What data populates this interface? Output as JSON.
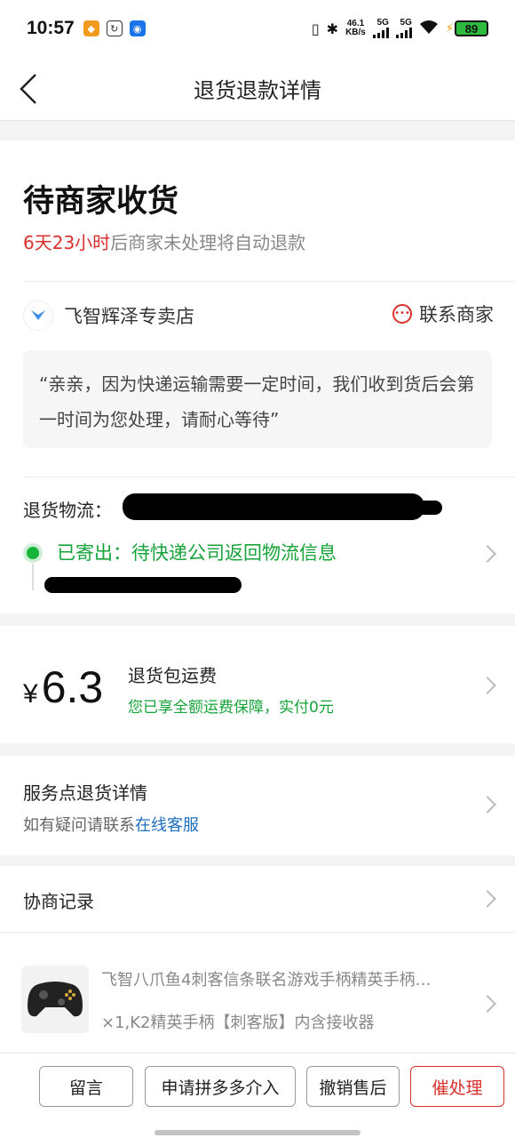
{
  "status_bar": {
    "time": "10:57",
    "net_speed_value": "46.1",
    "net_speed_unit": "KB/s",
    "sig1_label": "5G",
    "sig2_label": "5G",
    "battery": "89"
  },
  "nav": {
    "title": "退货退款详情"
  },
  "status": {
    "title": "待商家收货",
    "countdown": "6天23小时",
    "countdown_suffix": "后商家未处理将自动退款"
  },
  "shop": {
    "name": "飞智辉泽专卖店",
    "contact_label": "联系商家",
    "message": "“亲亲，因为快递运输需要一定时间，我们收到货后会第一时间为您处理，请耐心等待”"
  },
  "logistics": {
    "label": "退货物流：",
    "status": "已寄出：待快递公司返回物流信息"
  },
  "shipping_fee": {
    "currency": "¥",
    "amount": "6.3",
    "title": "退货包运费",
    "subtitle": "您已享全额运费保障，实付0元"
  },
  "service_point": {
    "title": "服务点退货详情",
    "sub_prefix": "如有疑问请联系",
    "sub_link": "在线客服"
  },
  "negotiation": {
    "title": "协商记录"
  },
  "product": {
    "name": "飞智八爪鱼4刺客信条联名游戏手柄精英手柄…",
    "spec": "×1,K2精英手柄【刺客版】内含接收器"
  },
  "actions": {
    "message": "留言",
    "intervene": "申请拼多多介入",
    "cancel": "撤销售后",
    "urge": "催处理"
  },
  "colors": {
    "accent_red": "#d8302a",
    "success_green": "#16a33a",
    "link_blue": "#1f6fbf"
  }
}
